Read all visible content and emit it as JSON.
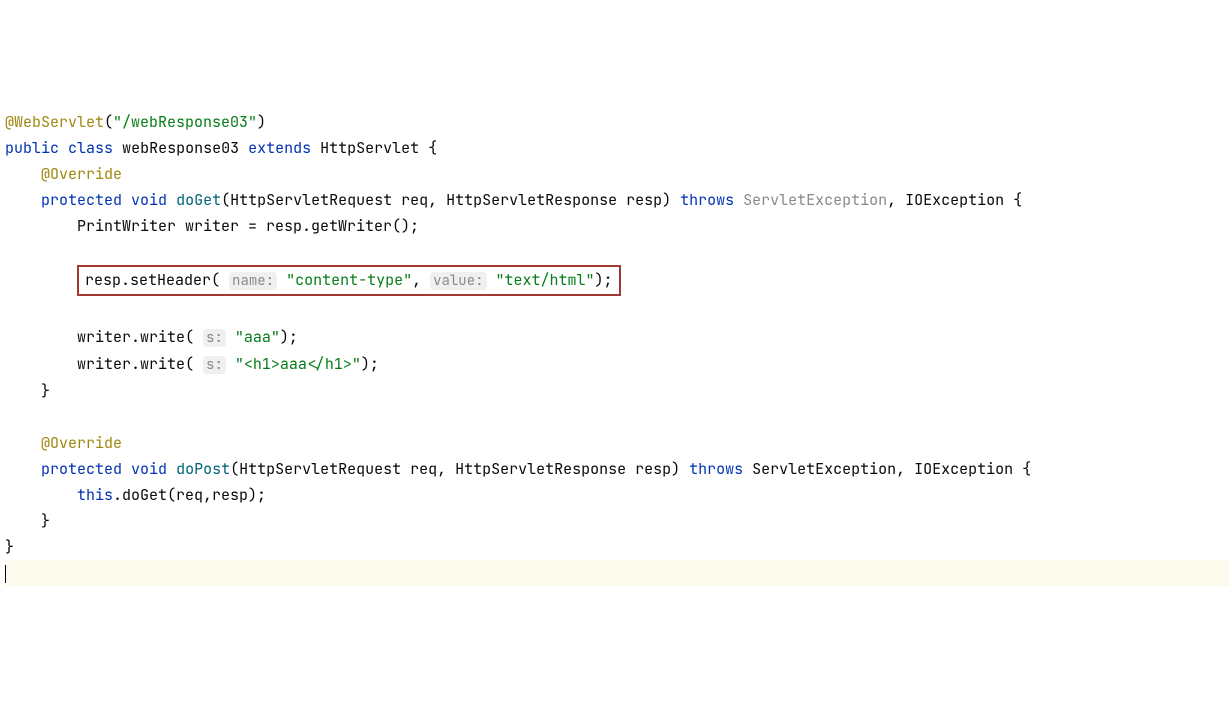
{
  "code": {
    "ann_webservlet": "@WebServlet",
    "servlet_path": "\"/webResponse03\"",
    "kw_public": "public",
    "kw_class": "class",
    "class_name": "webResponse03",
    "kw_extends": "extends",
    "superclass": "HttpServlet",
    "ann_override1": "@Override",
    "kw_protected1": "protected",
    "kw_void1": "void",
    "fn_doGet": "doGet",
    "params_get": "(HttpServletRequest req, HttpServletResponse resp)",
    "kw_throws1": "throws",
    "exc_servlet": "ServletException",
    "exc_rest1": ", IOException {",
    "line_writer": "PrintWriter writer = resp.getWriter();",
    "hl_pre": "resp.setHeader(",
    "hint_name": "name:",
    "hl_str1": "\"content-type\"",
    "hl_mid": ",",
    "hint_value": "value:",
    "hl_str2": "\"text/html\"",
    "hl_end": ");",
    "wr1_pre": "writer.write(",
    "hint_s1": "s:",
    "wr1_str": "\"aaa\"",
    "wr1_end": ");",
    "wr2_pre": "writer.write(",
    "hint_s2": "s:",
    "wr2_str": "\"<h1>aaa</h1>\"",
    "wr2_end": ");",
    "brace_close_method1": "}",
    "ann_override2": "@Override",
    "kw_protected2": "protected",
    "kw_void2": "void",
    "fn_doPost": "doPost",
    "params_post": "(HttpServletRequest req, HttpServletResponse resp)",
    "kw_throws2": "throws",
    "exc_rest2": "ServletException, IOException {",
    "kw_this": "this",
    "this_call": ".doGet(req,resp);",
    "brace_close_method2": "}",
    "brace_close_class": "}"
  }
}
